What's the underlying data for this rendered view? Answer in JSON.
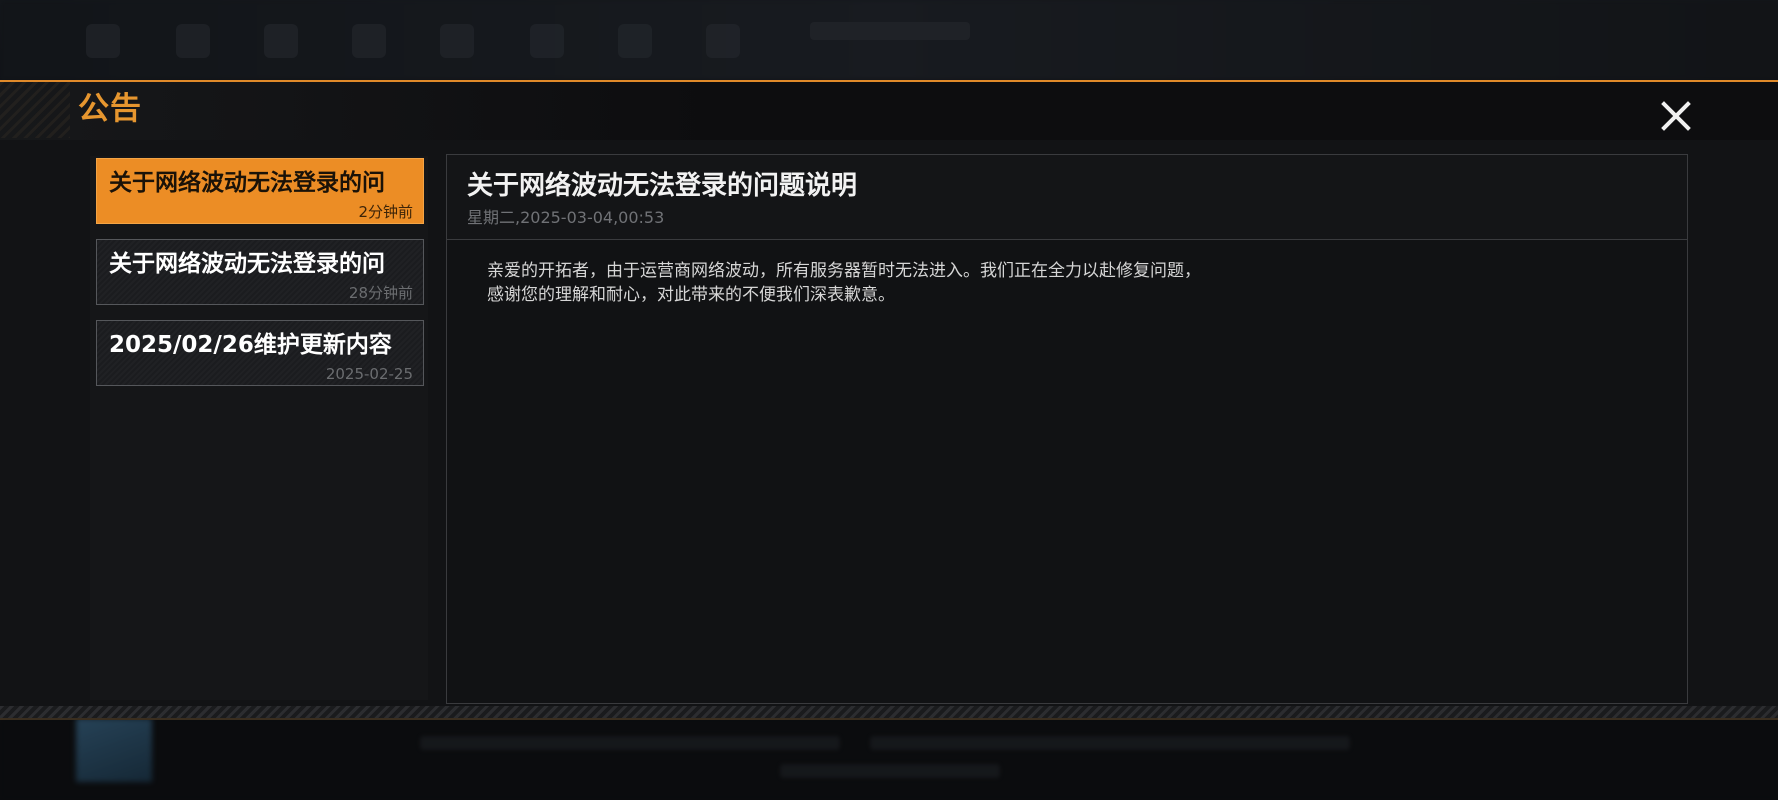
{
  "dialog": {
    "title": "公告",
    "close_icon": "close-x-icon"
  },
  "announcements": [
    {
      "title": "关于网络波动无法登录的问",
      "time": "2分钟前",
      "active": true
    },
    {
      "title": "关于网络波动无法登录的问",
      "time": "28分钟前",
      "active": false
    },
    {
      "title": "2025/02/26维护更新内容",
      "time": "2025-02-25",
      "active": false
    }
  ],
  "content": {
    "title": "关于网络波动无法登录的问题说明",
    "date": "星期二,2025-03-04,00:53",
    "lines": [
      "亲爱的开拓者，由于运营商网络波动，所有服务器暂时无法进入。我们正在全力以赴修复问题，",
      "感谢您的理解和耐心，对此带来的不便我们深表歉意。"
    ]
  },
  "colors": {
    "accent": "#ec8d25",
    "title_accent": "#e6962f",
    "background": "#121315"
  }
}
